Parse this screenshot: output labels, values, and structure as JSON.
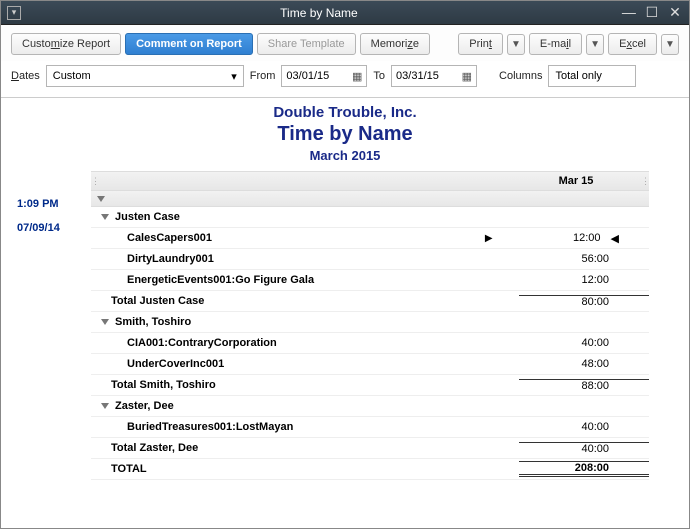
{
  "window": {
    "title": "Time by Name"
  },
  "toolbar": {
    "customize": "Customize Report",
    "comment": "Comment on Report",
    "share": "Share Template",
    "memorize": "Memorize",
    "print": "Print",
    "email": "E-mail",
    "excel": "Excel"
  },
  "filters": {
    "dates_label": "Dates",
    "dates_value": "Custom",
    "from_label": "From",
    "from_value": "03/01/15",
    "to_label": "To",
    "to_value": "03/31/15",
    "columns_label": "Columns",
    "columns_value": "Total only"
  },
  "meta": {
    "time": "1:09 PM",
    "date": "07/09/14"
  },
  "header": {
    "company": "Double Trouble, Inc.",
    "title": "Time by Name",
    "period": "March 2015"
  },
  "column_header": "Mar 15",
  "groups": [
    {
      "name": "Justen Case",
      "items": [
        {
          "name": "CalesCapers001",
          "value": "12:00",
          "cursor": true
        },
        {
          "name": "DirtyLaundry001",
          "value": "56:00"
        },
        {
          "name": "EnergeticEvents001:Go Figure Gala",
          "value": "12:00"
        }
      ],
      "total_label": "Total Justen Case",
      "total_value": "80:00"
    },
    {
      "name": "Smith, Toshiro",
      "items": [
        {
          "name": "CIA001:ContraryCorporation",
          "value": "40:00"
        },
        {
          "name": "UnderCoverInc001",
          "value": "48:00"
        }
      ],
      "total_label": "Total Smith, Toshiro",
      "total_value": "88:00"
    },
    {
      "name": "Zaster, Dee",
      "items": [
        {
          "name": "BuriedTreasures001:LostMayan",
          "value": "40:00"
        }
      ],
      "total_label": "Total Zaster, Dee",
      "total_value": "40:00"
    }
  ],
  "grand_total_label": "TOTAL",
  "grand_total_value": "208:00"
}
